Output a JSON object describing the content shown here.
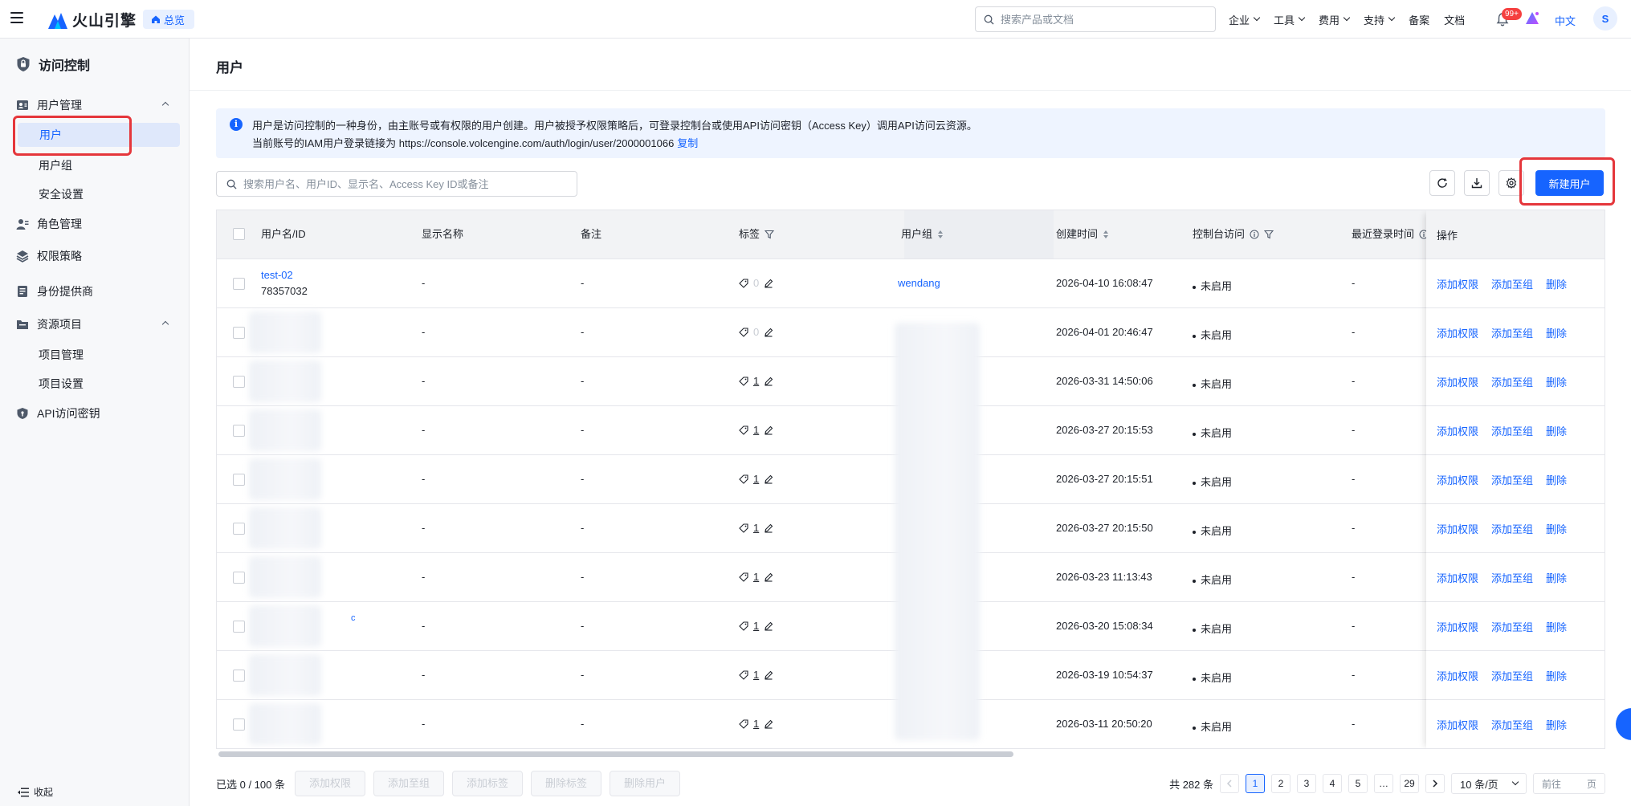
{
  "brand": {
    "name": "火山引擎",
    "home_label": "总览"
  },
  "topbar": {
    "search_placeholder": "搜索产品或文档",
    "nav": [
      "企业",
      "工具",
      "费用",
      "支持"
    ],
    "links": [
      "备案",
      "文档"
    ],
    "badge": "99+",
    "language": "中文",
    "avatar": "S"
  },
  "sidebar": {
    "title": "访问控制",
    "groups": [
      {
        "label": "用户管理",
        "children": [
          "用户",
          "用户组",
          "安全设置"
        ]
      },
      {
        "label": "角色管理"
      },
      {
        "label": "权限策略"
      },
      {
        "label": "身份提供商"
      },
      {
        "label": "资源项目",
        "children": [
          "项目管理",
          "项目设置"
        ]
      },
      {
        "label": "API访问密钥"
      }
    ],
    "collapse_label": "收起"
  },
  "page": {
    "title": "用户",
    "info_line1": "用户是访问控制的一种身份，由主账号或有权限的用户创建。用户被授予权限策略后，可登录控制台或使用API访问密钥（Access Key）调用API访问云资源。",
    "info_line2": "当前账号的IAM用户登录链接为 https://console.volcengine.com/auth/login/user/2000001066",
    "copy_label": "复制",
    "search_placeholder": "搜索用户名、用户ID、显示名、Access Key ID或备注",
    "create_button": "新建用户"
  },
  "table": {
    "columns": [
      "用户名/ID",
      "显示名称",
      "备注",
      "标签",
      "用户组",
      "创建时间",
      "控制台访问",
      "最近登录时间",
      "操作"
    ],
    "ops": [
      "添加权限",
      "添加至组",
      "删除"
    ],
    "rows": [
      {
        "name": "test-02",
        "id": "78357032",
        "display": "-",
        "remark": "-",
        "tags": "0",
        "group": "wendang",
        "created": "2026-04-10 16:08:47",
        "console": "未启用",
        "last_login": "-"
      },
      {
        "name": "",
        "id": "",
        "display": "-",
        "remark": "-",
        "tags": "0",
        "group": "",
        "created": "2026-04-01 20:46:47",
        "console": "未启用",
        "last_login": "-"
      },
      {
        "name": "",
        "id": "",
        "display": "-",
        "remark": "-",
        "tags": "1",
        "group": "",
        "created": "2026-03-31 14:50:06",
        "console": "未启用",
        "last_login": "-"
      },
      {
        "name": "",
        "id": "",
        "display": "-",
        "remark": "-",
        "tags": "1",
        "group": "",
        "created": "2026-03-27 20:15:53",
        "console": "未启用",
        "last_login": "-"
      },
      {
        "name": "",
        "id": "",
        "display": "-",
        "remark": "-",
        "tags": "1",
        "group": "",
        "created": "2026-03-27 20:15:51",
        "console": "未启用",
        "last_login": "-"
      },
      {
        "name": "",
        "id": "",
        "display": "-",
        "remark": "-",
        "tags": "1",
        "group": "",
        "created": "2026-03-27 20:15:50",
        "console": "未启用",
        "last_login": "-"
      },
      {
        "name": "",
        "id": "",
        "display": "-",
        "remark": "-",
        "tags": "1",
        "group": "",
        "created": "2026-03-23 11:13:43",
        "console": "未启用",
        "last_login": "-"
      },
      {
        "name": "c",
        "id": "",
        "display": "-",
        "remark": "-",
        "tags": "1",
        "group": "",
        "created": "2026-03-20 15:08:34",
        "console": "未启用",
        "last_login": "-"
      },
      {
        "name": "",
        "id": "",
        "display": "-",
        "remark": "-",
        "tags": "1",
        "group": "",
        "created": "2026-03-19 10:54:37",
        "console": "未启用",
        "last_login": "-"
      },
      {
        "name": "",
        "id": "",
        "display": "-",
        "remark": "-",
        "tags": "1",
        "group": "",
        "created": "2026-03-11 20:50:20",
        "console": "未启用",
        "last_login": "-"
      }
    ]
  },
  "footer": {
    "selected": "已选 0 / 100 条",
    "batch_buttons": [
      "添加权限",
      "添加至组",
      "添加标签",
      "删除标签",
      "删除用户"
    ],
    "total": "共 282 条",
    "pages": [
      "1",
      "2",
      "3",
      "4",
      "5",
      "…",
      "29"
    ],
    "page_size": "10 条/页",
    "goto_label": "前往",
    "goto_unit": "页"
  },
  "colors": {
    "primary": "#1664ff",
    "highlight": "#e5363b"
  }
}
